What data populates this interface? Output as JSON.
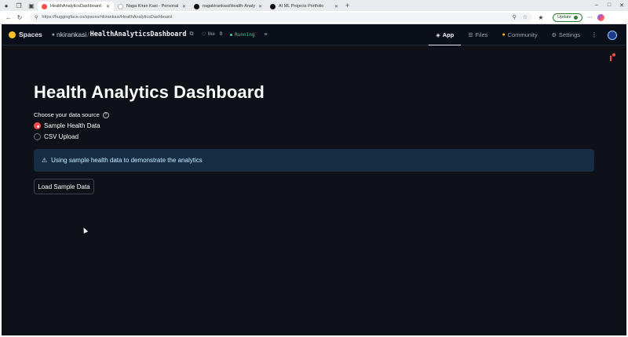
{
  "browser": {
    "tabs": [
      {
        "label": "HealthAnalyticsDashboard -",
        "active": true,
        "favicon_color": "#ff4b4b"
      },
      {
        "label": "Naga Kiran Kasi - Personal Portfo",
        "active": false,
        "favicon_color": "#ffffff"
      },
      {
        "label": "nagakirankasi/Health-Analytics-D",
        "active": false,
        "favicon_color": "#111111"
      },
      {
        "label": "AI ML Projects Portfolio",
        "active": false,
        "favicon_color": "#111111"
      }
    ],
    "url": "https://huggingface.co/spaces/nkirankasi/HealthAnalyticsDashboard",
    "update_label": "Update"
  },
  "header": {
    "brand": "Spaces",
    "owner": "nkirankasi",
    "separator": "/",
    "repo": "HealthAnalyticsDashboard",
    "like_label": "like",
    "like_count": "0",
    "status": "Running",
    "nav": [
      {
        "label": "App",
        "icon": "app-icon",
        "active": true
      },
      {
        "label": "Files",
        "icon": "files-icon",
        "active": false
      },
      {
        "label": "Community",
        "icon": "community-icon",
        "active": false
      },
      {
        "label": "Settings",
        "icon": "gear-icon",
        "active": false
      }
    ]
  },
  "app": {
    "title": "Health Analytics Dashboard",
    "source_label": "Choose your data source",
    "options": [
      {
        "label": "Sample Health Data",
        "selected": true
      },
      {
        "label": "CSV Upload",
        "selected": false
      }
    ],
    "info_message": "Using sample health data to demonstrate the analytics",
    "load_button": "Load Sample Data"
  },
  "colors": {
    "accent": "#ff4b4b",
    "app_bg": "#0e1117",
    "header_bg": "#0b0f19",
    "info_bg": "#172d43",
    "running": "#34d399"
  }
}
